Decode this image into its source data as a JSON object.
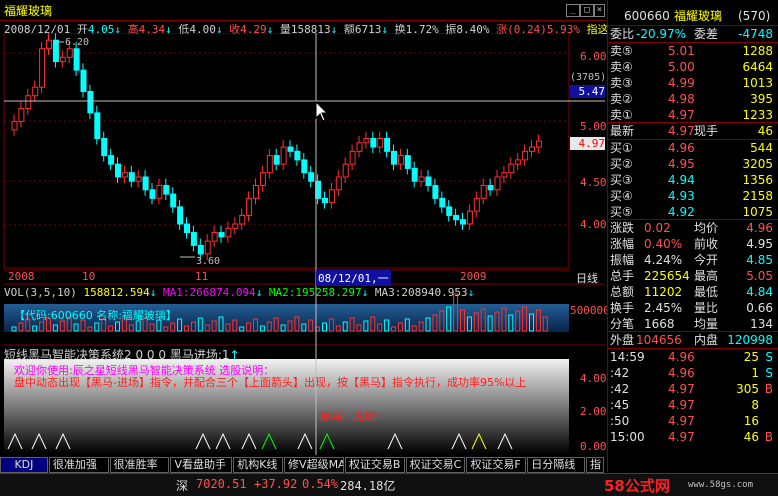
{
  "header": {
    "title": "福耀玻璃",
    "info": {
      "date": "2008/12/01",
      "open_label": "开",
      "open": "4.05",
      "high_label": "高",
      "high": "4.34",
      "low_label": "低",
      "low": "4.00",
      "close_label": "收",
      "close": "4.29",
      "vol_label": "量",
      "vol": "158813",
      "amount_label": "额",
      "amount": "6713",
      "turnover_label": "换",
      "turnover": "1.72%",
      "amp_label": "振",
      "amp": "8.40%",
      "chg_label": "涨",
      "chg": "(0.24)5.93%",
      "extra": "指这"
    }
  },
  "price_chart": {
    "y_ticks": [
      "6.00",
      "5.50",
      "5.00",
      "4.50",
      "4.00"
    ],
    "max_label": "6.20",
    "min_label": "3.60",
    "cursor_label": "(3705)",
    "cursor_value": "5.47",
    "last_price_tag": "4.97",
    "x_labels": [
      "2008",
      "10",
      "11",
      "08/12/01,一",
      "2009",
      "日线"
    ]
  },
  "volume": {
    "legend": "VOL(3,5,10)",
    "v1": "158812.594",
    "ma1": "MA1:266874.094",
    "ma2": "MA2:195258.297",
    "ma3": "MA3:208940.953",
    "scale": "500000",
    "watermark": "【代码:600660 名称:福耀玻璃】"
  },
  "indicator": {
    "name": "短线黑马智能决策系统2",
    "values": "0 0 0",
    "signal": "黑马进场:1",
    "msg1": "欢迎你使用:辰之星短线黑马智能决策系统  选股说明：",
    "msg2": "盘中动态出现【黑马-进场】指令，并配合三个【上面箭头】出现，按【黑马】指令执行，成功率95%以上",
    "msg3": "黑马：进场!",
    "y_ticks": [
      "4.00",
      "2.00",
      "0.00"
    ]
  },
  "tabs": [
    "KDJ",
    "很准加强",
    "很准胜率",
    "V看盘助手",
    "机构K线",
    "修V超级MACD",
    "权证交易B",
    "权证交易C",
    "权证交易F",
    "日分隔线",
    "指"
  ],
  "status_bar": {
    "market": "深",
    "index": "7020.51",
    "change": "+37.92",
    "pct": "0.54%",
    "amount": "284.18亿",
    "logo": "58公式网",
    "site": "www.58gs.com"
  },
  "quote_panel": {
    "code": "600660",
    "name": "福耀玻璃",
    "num": "(570)",
    "weibi_label": "委比",
    "weibi": "-20.97%",
    "weicha_label": "委差",
    "weicha": "-4748",
    "sells": [
      {
        "label": "卖⑤",
        "price": "5.01",
        "vol": "1288"
      },
      {
        "label": "卖④",
        "price": "5.00",
        "vol": "6464"
      },
      {
        "label": "卖③",
        "price": "4.99",
        "vol": "1013"
      },
      {
        "label": "卖②",
        "price": "4.98",
        "vol": "395"
      },
      {
        "label": "卖①",
        "price": "4.97",
        "vol": "1233"
      }
    ],
    "latest_label": "最新",
    "latest": "4.97",
    "xianshou_label": "现手",
    "xianshou": "46",
    "buys": [
      {
        "label": "买①",
        "price": "4.96",
        "vol": "544"
      },
      {
        "label": "买②",
        "price": "4.95",
        "vol": "3205"
      },
      {
        "label": "买③",
        "price": "4.94",
        "vol": "1356"
      },
      {
        "label": "买④",
        "price": "4.93",
        "vol": "2158"
      },
      {
        "label": "买⑤",
        "price": "4.92",
        "vol": "1075"
      }
    ],
    "stats": [
      {
        "l1": "涨跌",
        "v1": "0.02",
        "l2": "均价",
        "v2": "4.96"
      },
      {
        "l1": "涨幅",
        "v1": "0.40%",
        "l2": "前收",
        "v2": "4.95"
      },
      {
        "l1": "振幅",
        "v1": "4.24%",
        "l2": "今开",
        "v2": "4.85"
      },
      {
        "l1": "总手",
        "v1": "225654",
        "l2": "最高",
        "v2": "5.05"
      },
      {
        "l1": "总额",
        "v1": "11202",
        "l2": "最低",
        "v2": "4.84"
      },
      {
        "l1": "换手",
        "v1": "2.45%",
        "l2": "量比",
        "v2": "0.66"
      },
      {
        "l1": "分笔",
        "v1": "1668",
        "l2": "均量",
        "v2": "134"
      }
    ],
    "waipan_label": "外盘",
    "waipan": "104656",
    "neipan_label": "内盘",
    "neipan": "120998",
    "ticks": [
      {
        "time": "14:59",
        "price": "4.96",
        "vol": "25",
        "dir": "S"
      },
      {
        "time": ":42",
        "price": "4.96",
        "vol": "1",
        "dir": "S"
      },
      {
        "time": ":42",
        "price": "4.97",
        "vol": "305",
        "dir": "B"
      },
      {
        "time": ":45",
        "price": "4.97",
        "vol": "8",
        "dir": ""
      },
      {
        "time": ":50",
        "price": "4.97",
        "vol": "16",
        "dir": ""
      },
      {
        "time": "15:00",
        "price": "4.97",
        "vol": "46",
        "dir": "B"
      }
    ]
  },
  "colors": {
    "up": "#ff3030",
    "down": "#00ffff",
    "frame": "#800000",
    "yellow": "#ffff00"
  }
}
